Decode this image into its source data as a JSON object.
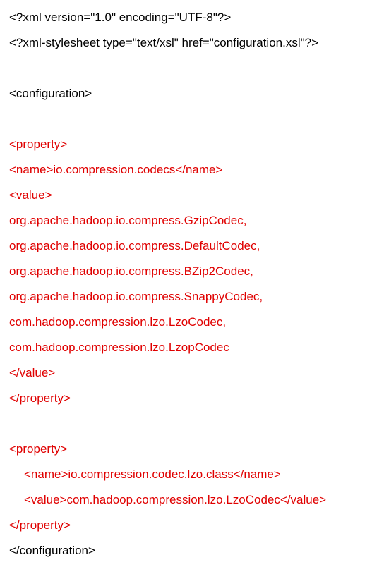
{
  "document": {
    "colors": {
      "default_text": "#000000",
      "highlight_text": "#e00000"
    },
    "lines": [
      {
        "text": "<?xml version=\"1.0\" encoding=\"UTF-8\"?>",
        "color": "black"
      },
      {
        "text": "<?xml-stylesheet type=\"text/xsl\" href=\"configuration.xsl\"?>",
        "color": "black"
      },
      {
        "text": "",
        "color": "black"
      },
      {
        "text": "<configuration>",
        "color": "black"
      },
      {
        "text": "",
        "color": "black"
      },
      {
        "text": "<property>",
        "color": "red"
      },
      {
        "text": "<name>io.compression.codecs</name>",
        "color": "red"
      },
      {
        "text": "<value>",
        "color": "red"
      },
      {
        "text": "org.apache.hadoop.io.compress.GzipCodec,",
        "color": "red"
      },
      {
        "text": "org.apache.hadoop.io.compress.DefaultCodec,",
        "color": "red"
      },
      {
        "text": "org.apache.hadoop.io.compress.BZip2Codec,",
        "color": "red"
      },
      {
        "text": "org.apache.hadoop.io.compress.SnappyCodec,",
        "color": "red"
      },
      {
        "text": "com.hadoop.compression.lzo.LzoCodec,",
        "color": "red"
      },
      {
        "text": "com.hadoop.compression.lzo.LzopCodec",
        "color": "red"
      },
      {
        "text": "</value>",
        "color": "red"
      },
      {
        "text": "</property>",
        "color": "red"
      },
      {
        "text": "",
        "color": "black"
      },
      {
        "text": "<property>",
        "color": "red"
      },
      {
        "text": "<name>io.compression.codec.lzo.class</name>",
        "color": "red"
      },
      {
        "text": "<value>com.hadoop.compression.lzo.LzoCodec</value>",
        "color": "red"
      },
      {
        "text": "</property>",
        "color": "red"
      },
      {
        "text": "</configuration>",
        "color": "black"
      }
    ]
  }
}
